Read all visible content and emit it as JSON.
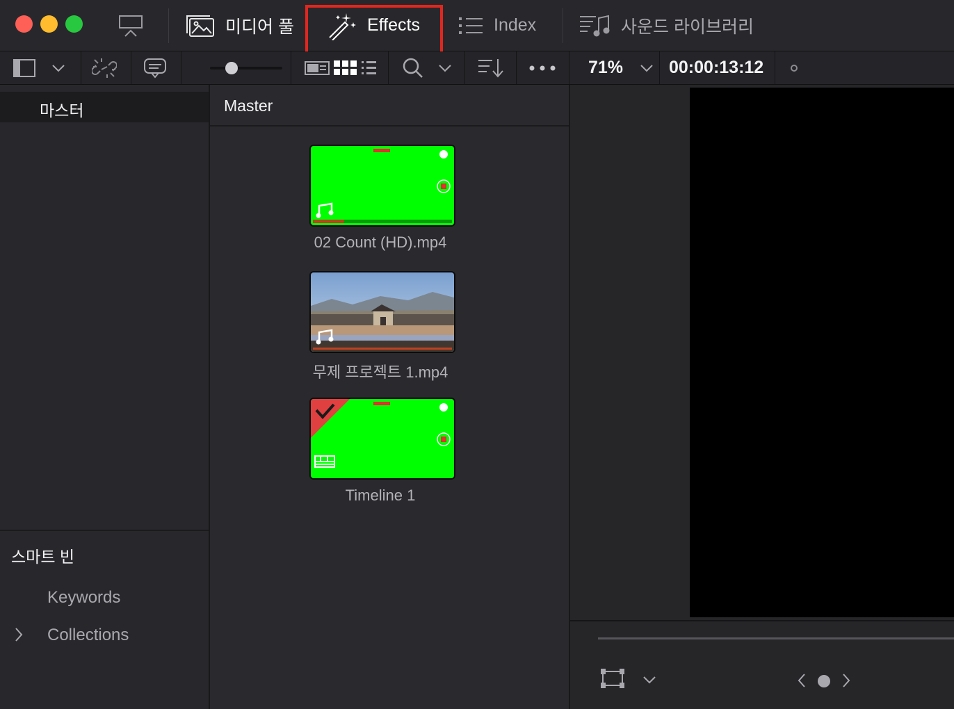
{
  "window": {
    "traffic_lights": {
      "close": "#fe5f57",
      "minimize": "#febc2e",
      "zoom": "#28c840"
    }
  },
  "tabs": [
    {
      "label": "미디어 풀",
      "icon": "media-pool-icon"
    },
    {
      "label": "Effects",
      "icon": "magic-wand-icon",
      "highlighted": true
    },
    {
      "label": "Index",
      "icon": "list-icon"
    },
    {
      "label": "사운드 라이브러리",
      "icon": "sound-library-icon"
    }
  ],
  "highlight_color": "#e0271f",
  "toolbar": {
    "zoom_value": "71%",
    "timecode": "00:00:13:12",
    "thumbnail_size_fraction": 0.25
  },
  "sidebar": {
    "master_label": "마스터",
    "smart_bin_title": "스마트 빈",
    "smart_bins": [
      {
        "label": "Keywords",
        "expandable": false
      },
      {
        "label": "Collections",
        "expandable": true
      }
    ]
  },
  "bins": {
    "title": "Master",
    "clips": [
      {
        "name": "02 Count (HD).mp4",
        "type": "audio-video",
        "thumbnail": "green-screen"
      },
      {
        "name": "무제 프로젝트 1.mp4",
        "type": "audio-video",
        "thumbnail": "palace-photo"
      },
      {
        "name": "Timeline 1",
        "type": "timeline",
        "thumbnail": "green-screen",
        "checked": true
      }
    ],
    "green_screen_color": "#00ff00"
  }
}
